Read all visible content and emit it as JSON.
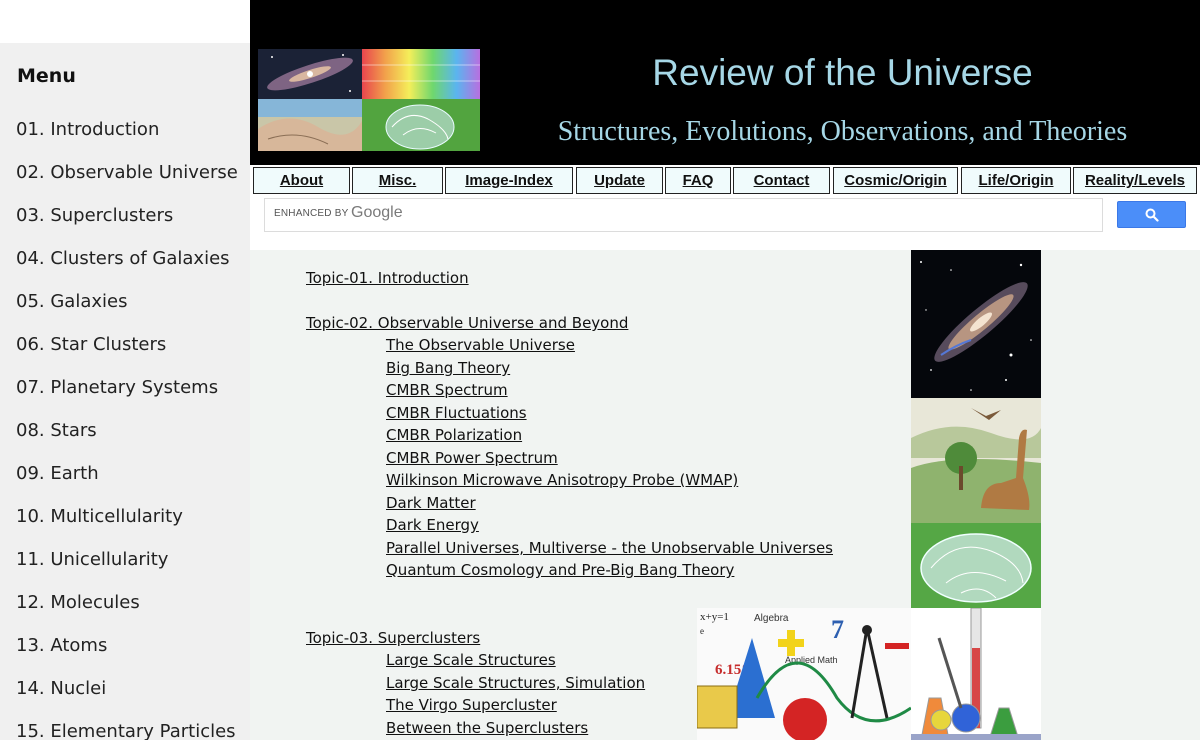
{
  "sidebar": {
    "title": "Menu",
    "items": [
      "01. Introduction",
      "02. Observable Universe",
      "03. Superclusters",
      "04. Clusters of Galaxies",
      "05. Galaxies",
      "06. Star Clusters",
      "07. Planetary Systems",
      "08. Stars",
      "09. Earth",
      "10. Multicellularity",
      "11. Unicellularity",
      "12. Molecules",
      "13. Atoms",
      "14. Nuclei",
      "15. Elementary Particles"
    ]
  },
  "header": {
    "title": "Review of the Universe",
    "subtitle": "Structures, Evolutions, Observations, and Theories"
  },
  "nav": [
    "About",
    "Misc.",
    "Image-Index",
    "Update",
    "FAQ",
    "Contact",
    "Cosmic/Origin",
    "Life/Origin",
    "Reality/Levels"
  ],
  "search": {
    "brand_prefix": "ENHANCED BY",
    "brand_name": "Google",
    "placeholder": ""
  },
  "content": {
    "topics": [
      {
        "title": "Topic-01. Introduction",
        "subtopics": []
      },
      {
        "title": "Topic-02. Observable Universe and Beyond",
        "subtopics": [
          "The Observable Universe",
          "Big Bang Theory",
          "CMBR Spectrum",
          "CMBR Fluctuations",
          "CMBR Polarization",
          "CMBR Power Spectrum",
          "Wilkinson Microwave Anisotropy Probe (WMAP)",
          "Dark Matter",
          "Dark Energy",
          "Parallel Universes, Multiverse - the Unobservable Universes",
          "Quantum Cosmology and Pre-Big Bang Theory"
        ]
      },
      {
        "title": "Topic-03. Superclusters",
        "subtopics": [
          "Large Scale Structures",
          "Large Scale Structures, Simulation",
          "The Virgo Supercluster",
          "Between the Superclusters"
        ]
      }
    ],
    "math_image": {
      "text_eq1": "x+y=1",
      "text_algebra": "Algebra",
      "text_euler": "e",
      "text_percent": "6.15%",
      "text_seven": "7",
      "text_applied": "Applied Math"
    }
  }
}
